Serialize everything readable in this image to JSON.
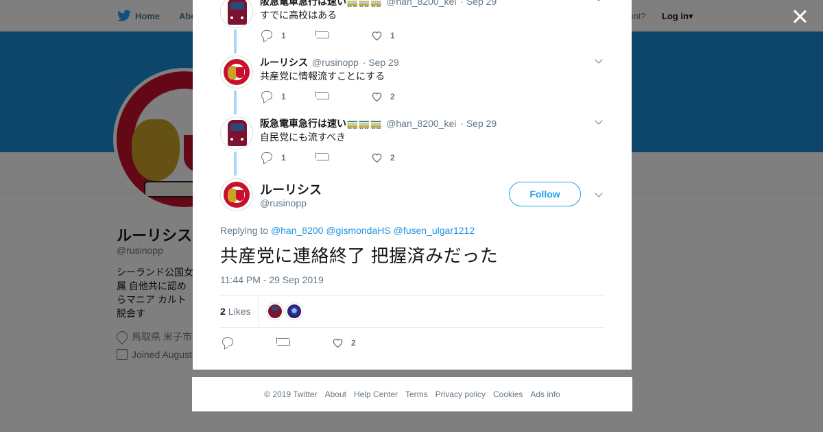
{
  "background": {
    "nav": {
      "home": "Home",
      "about": "Abo",
      "account_prompt": "ccount?",
      "login": "Log in▾"
    },
    "profile": {
      "name": "ルーリシス",
      "handle": "@rusinopp",
      "bio": "シーランド公国女属 自他共に認めらマニア カルト脱会す",
      "location": "鳥取県 米子市",
      "joined": "Joined August"
    },
    "colors": {
      "banner": "#1d8bd6"
    }
  },
  "thread": [
    {
      "name": "阪急電車急行は速い🚃🚃🚃",
      "handle": "@han_8200_kei",
      "date": "· Sep 29",
      "text": "すでに高校はある",
      "replies": "1",
      "retweets": "",
      "likes": "1",
      "avatar": "train-avatar"
    },
    {
      "name": "ルーリシス",
      "handle": "@rusinopp",
      "date": "· Sep 29",
      "text": "共産党に情報流すことにする",
      "replies": "1",
      "retweets": "",
      "likes": "2",
      "avatar": "crest-avatar"
    },
    {
      "name": "阪急電車急行は速い🚃🚃🚃",
      "handle": "@han_8200_kei",
      "date": "· Sep 29",
      "text": "自民党にも流すべき",
      "replies": "1",
      "retweets": "",
      "likes": "2",
      "avatar": "train-avatar"
    }
  ],
  "main_tweet": {
    "name": "ルーリシス",
    "handle": "@rusinopp",
    "follow_label": "Follow",
    "replying_prefix": "Replying to",
    "replying_to": [
      "@han_8200",
      "@gismondaHS",
      "@fusen_ulgar1212"
    ],
    "text": "共産党に連絡終了 把握済みだった",
    "timestamp": "11:44 PM - 29 Sep 2019",
    "likes_count": "2",
    "likes_label": "Likes",
    "actions": {
      "replies": "",
      "retweets": "",
      "likes": "2"
    }
  },
  "footer": [
    "© 2019 Twitter",
    "About",
    "Help Center",
    "Terms",
    "Privacy policy",
    "Cookies",
    "Ads info"
  ],
  "colors": {
    "link": "#1b95e0",
    "follow": "#1da1f2",
    "thread_line": "#a4d9f7",
    "overlay": "rgba(0,0,0,0.5)"
  }
}
